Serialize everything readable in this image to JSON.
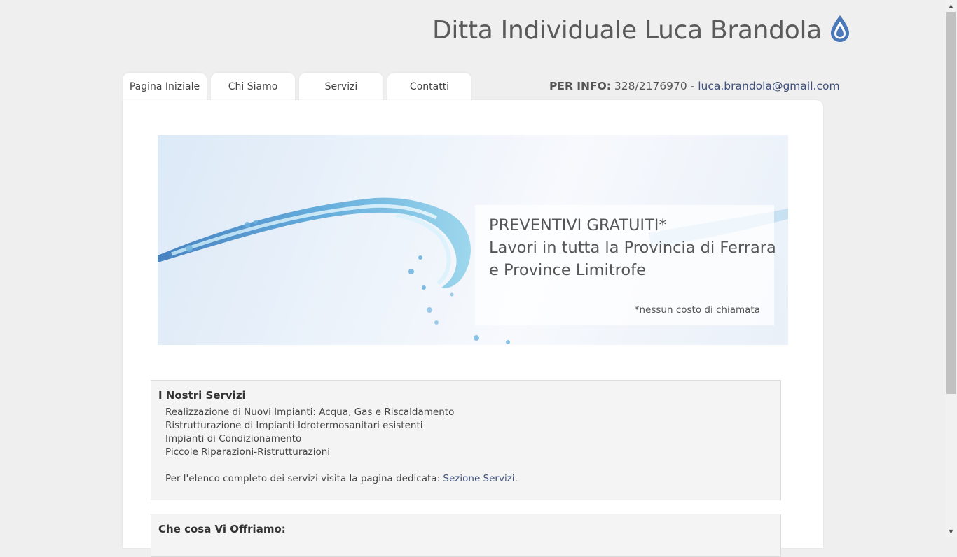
{
  "header": {
    "title": "Ditta Individuale Luca Brandola",
    "logo_icon": "water-drop-icon",
    "accent_color": "#4a78b8"
  },
  "nav": {
    "tabs": [
      {
        "label": "Pagina Iniziale",
        "active": true
      },
      {
        "label": "Chi Siamo"
      },
      {
        "label": "Servizi"
      },
      {
        "label": "Contatti"
      }
    ]
  },
  "info": {
    "label": "PER INFO:",
    "phone": "328/2176970",
    "separator": "-",
    "email": "luca.brandola@gmail.com"
  },
  "hero": {
    "line1": "PREVENTIVI GRATUITI*",
    "line2": "Lavori in tutta la Provincia di Ferrara",
    "line3": "e Province Limitrofe",
    "note": "*nessun costo di chiamata"
  },
  "services": {
    "title": "I Nostri Servizi",
    "items": [
      "Realizzazione di Nuovi Impianti: Acqua, Gas e Riscaldamento",
      "Ristrutturazione di Impianti Idrotermosanitari esistenti",
      "Impianti di Condizionamento",
      "Piccole Riparazioni-Ristrutturazioni"
    ],
    "note_prefix": "Per l'elenco completo dei servizi visita la pagina dedicata:",
    "note_link": "Sezione Servizi",
    "note_suffix": "."
  },
  "offer": {
    "title": "Che cosa Vi Offriamo:"
  }
}
